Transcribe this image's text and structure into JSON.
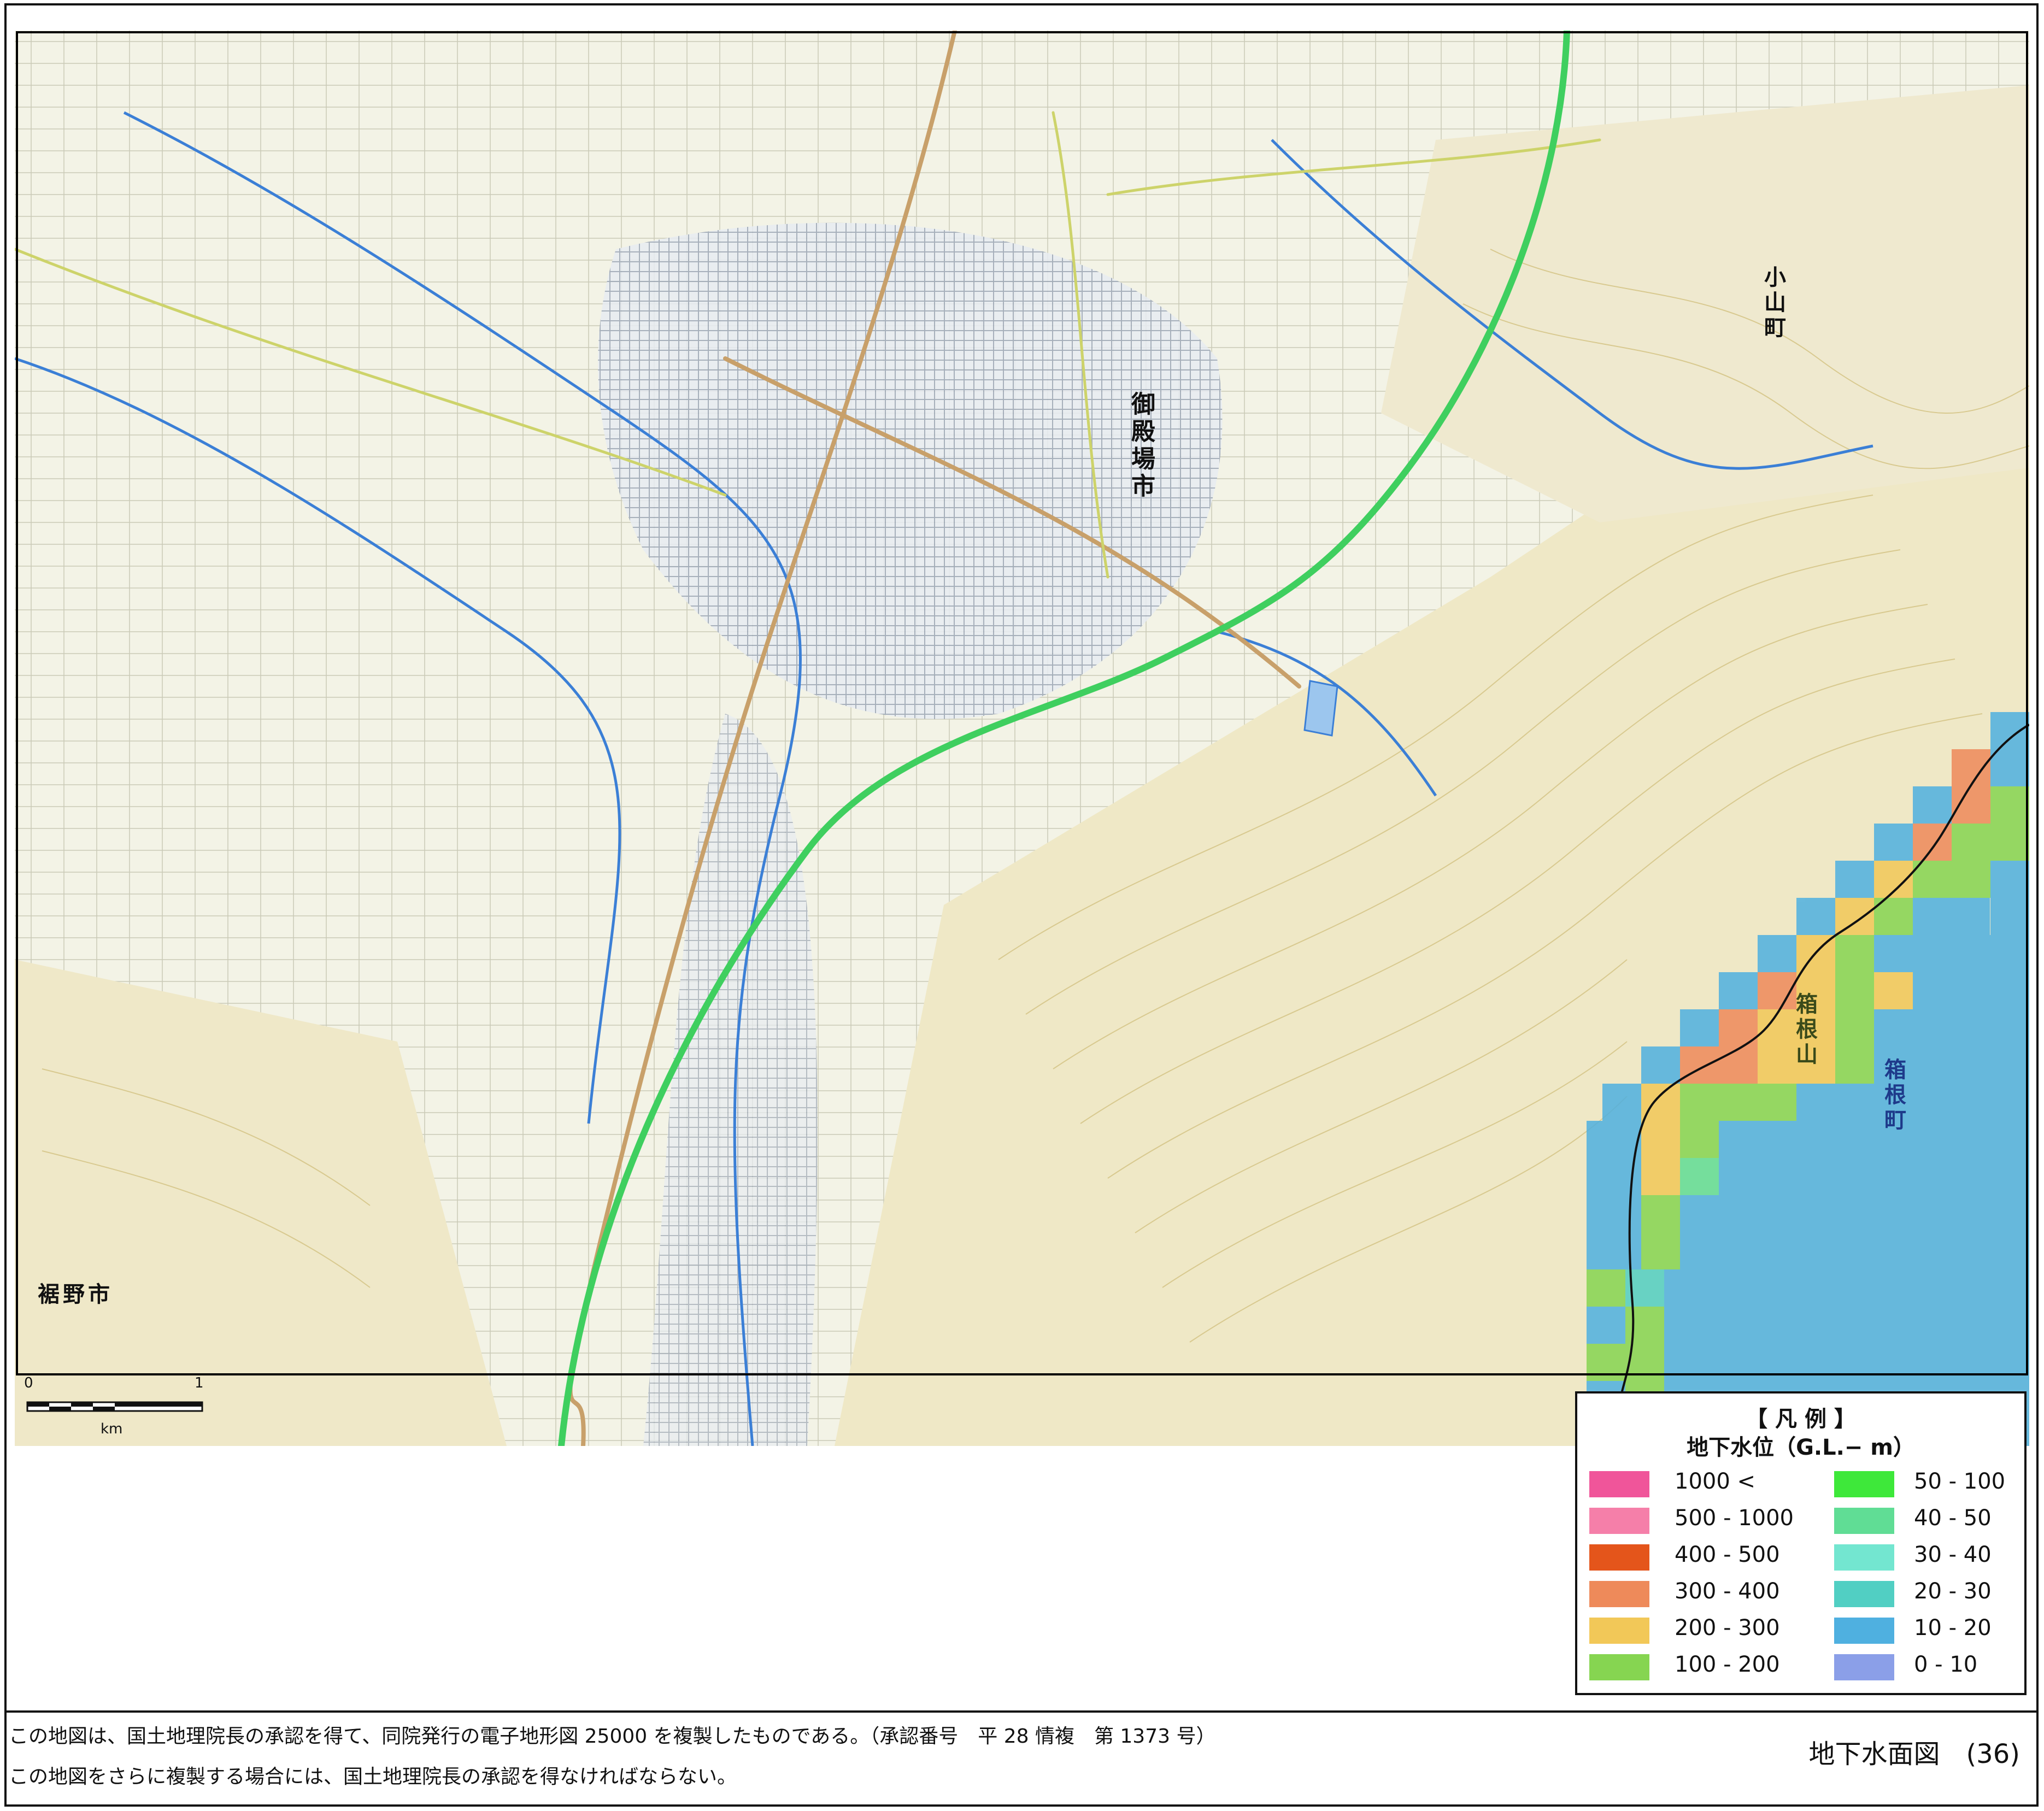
{
  "map": {
    "place_labels": {
      "gotemba": "御殿場市",
      "oyama": "小山町",
      "susono": "裾野市",
      "hakone_town": "箱根町",
      "hakone_mountain": "箱根山"
    }
  },
  "scale_bar": {
    "zero": "0",
    "one": "1",
    "unit": "km"
  },
  "legend": {
    "title": "【 凡 例 】",
    "subtitle": "地下水位（G.L.− m）",
    "items": [
      {
        "label": "1000 <",
        "color": "#f0559a"
      },
      {
        "label": "500 - 1000",
        "color": "#f57fa9"
      },
      {
        "label": "400 - 500",
        "color": "#e4551b"
      },
      {
        "label": "300 - 400",
        "color": "#ee8a5a"
      },
      {
        "label": "200 - 300",
        "color": "#f2c858"
      },
      {
        "label": "100 - 200",
        "color": "#86d551"
      },
      {
        "label": "50 - 100",
        "color": "#3ee83a"
      },
      {
        "label": "40 - 50",
        "color": "#60dd95"
      },
      {
        "label": "30 - 40",
        "color": "#73e6d0"
      },
      {
        "label": "20 - 30",
        "color": "#51cfc3"
      },
      {
        "label": "10 - 20",
        "color": "#4fb0e0"
      },
      {
        "label": "0 - 10",
        "color": "#8b9fe8"
      }
    ]
  },
  "footer": {
    "notice_line1": "この地図は、国土地理院長の承認を得て、同院発行の電子地形図 25000 を複製したものである。（承認番号　平 28 情複　第 1373 号）",
    "notice_line2": "この地図をさらに複製する場合には、国土地理院長の承認を得なければならない。",
    "sheet_title": "地下水面図　(36)"
  }
}
